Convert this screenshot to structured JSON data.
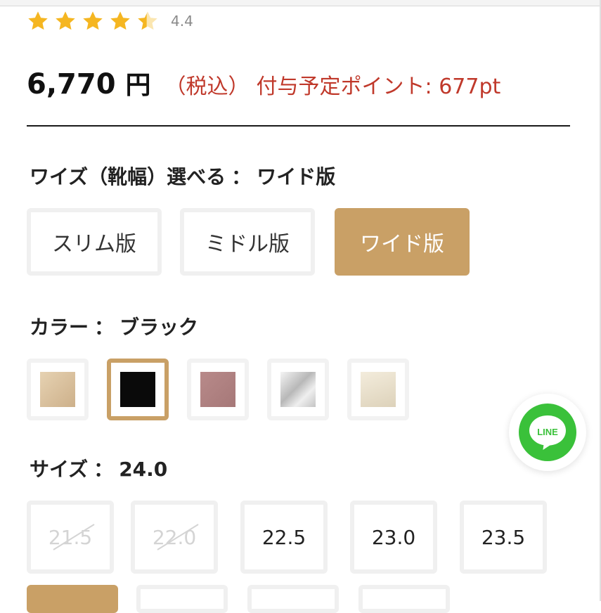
{
  "rating": {
    "value": "4.4",
    "stars_filled": 4.4,
    "star_color": "#f5b621"
  },
  "price": {
    "amount": "6,770",
    "currency": "円",
    "tax_label": "（税込）",
    "points_label": "付与予定ポイント: 677pt",
    "accent_color": "#c0392b"
  },
  "width_option": {
    "label": "ワイズ（靴幅）選べる",
    "separator": "：",
    "selected": "ワイド版",
    "options": [
      "スリム版",
      "ミドル版",
      "ワイド版"
    ],
    "selected_color": "#c9a066"
  },
  "color_option": {
    "label": "カラー",
    "separator": "：",
    "selected": "ブラック",
    "swatches": [
      {
        "name": "beige-swatch",
        "color": "#dcc6a4"
      },
      {
        "name": "black-swatch",
        "color": "#0a0a0a"
      },
      {
        "name": "mauve-swatch",
        "color": "#b08080"
      },
      {
        "name": "silver-swatch",
        "color": "#d8d8d8"
      },
      {
        "name": "ivory-swatch",
        "color": "#ece4d0"
      }
    ]
  },
  "size_option": {
    "label": "サイズ",
    "separator": "：",
    "selected": "24.0",
    "sizes": [
      {
        "value": "21.5",
        "available": false
      },
      {
        "value": "22.0",
        "available": false
      },
      {
        "value": "22.5",
        "available": true
      },
      {
        "value": "23.0",
        "available": true
      },
      {
        "value": "23.5",
        "available": true
      }
    ]
  },
  "line_badge": {
    "text": "LINE",
    "color": "#3ac13a"
  }
}
